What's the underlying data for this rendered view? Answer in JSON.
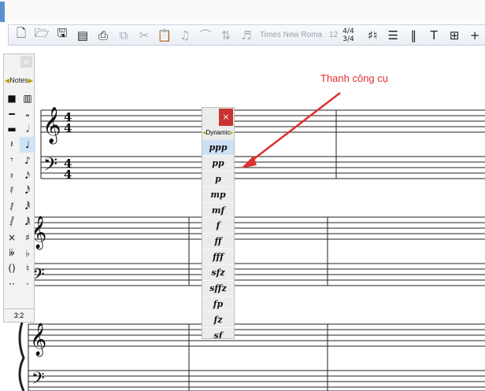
{
  "toolbar": {
    "font_name": "Times New Roma",
    "font_size": "12",
    "time_sig": "4/4 3/4"
  },
  "notes_palette": {
    "title": "Notes",
    "footer": "3:2",
    "rows": [
      [
        "■",
        "▥"
      ],
      [
        "━",
        "𝅝"
      ],
      [
        "▬",
        "𝅗𝅥"
      ],
      [
        "𝄽",
        "♩"
      ],
      [
        "𝄾",
        "♪"
      ],
      [
        "𝄿",
        "𝅘𝅥𝅯"
      ],
      [
        "𝅀",
        "𝅘𝅥𝅰"
      ],
      [
        "𝅁",
        "𝅘𝅥𝅱"
      ],
      [
        "𝅂",
        "𝅘𝅥𝅲"
      ],
      [
        "×",
        "♯"
      ],
      [
        "𝄫",
        "♭"
      ],
      [
        "()",
        "♮"
      ],
      [
        "··",
        "·"
      ]
    ]
  },
  "dynamics_palette": {
    "title": "Dynamic",
    "items": [
      "ppp",
      "pp",
      "p",
      "mp",
      "mf",
      "f",
      "ff",
      "fff",
      "sfz",
      "sffz",
      "fp",
      "fz",
      "sf"
    ]
  },
  "annotation": {
    "text": "Thanh công cụ",
    "color": "#e03030"
  },
  "score": {
    "time_signature_top": "4",
    "time_signature_bottom": "4"
  }
}
